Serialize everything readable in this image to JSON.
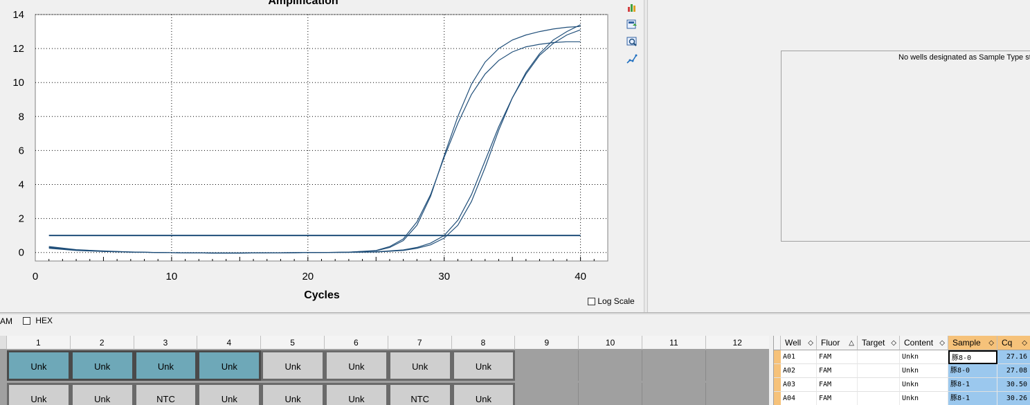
{
  "chart_data": {
    "type": "line",
    "title": "Amplification",
    "xlabel": "Cycles",
    "ylabel": "",
    "xlim": [
      0,
      42
    ],
    "ylim": [
      -0.5,
      14
    ],
    "xticks": [
      0,
      10,
      20,
      30,
      40
    ],
    "yticks": [
      0,
      2,
      4,
      6,
      8,
      10,
      12,
      14
    ],
    "grid": true,
    "threshold": 1.0,
    "series": [
      {
        "color": "#1f4e79",
        "x": [
          1,
          3,
          5,
          7,
          9,
          11,
          13,
          15,
          17,
          19,
          21,
          23,
          25,
          26,
          27,
          28,
          29,
          30,
          31,
          32,
          33,
          34,
          35,
          36,
          37,
          38,
          39,
          40
        ],
        "y": [
          0.3,
          0.15,
          0.08,
          0.03,
          0.0,
          -0.02,
          -0.03,
          -0.03,
          -0.02,
          -0.01,
          0.0,
          0.02,
          0.1,
          0.3,
          0.7,
          1.6,
          3.3,
          5.7,
          8.0,
          9.9,
          11.2,
          12.0,
          12.5,
          12.8,
          13.0,
          13.15,
          13.25,
          13.3
        ]
      },
      {
        "color": "#1f4e79",
        "x": [
          1,
          3,
          5,
          7,
          9,
          11,
          13,
          15,
          17,
          19,
          21,
          23,
          25,
          26,
          27,
          28,
          29,
          30,
          31,
          32,
          33,
          34,
          35,
          36,
          37,
          38,
          39,
          40
        ],
        "y": [
          0.35,
          0.17,
          0.09,
          0.03,
          0.0,
          -0.02,
          -0.03,
          -0.03,
          -0.02,
          -0.01,
          0.0,
          0.02,
          0.12,
          0.35,
          0.8,
          1.8,
          3.4,
          5.6,
          7.6,
          9.3,
          10.5,
          11.3,
          11.8,
          12.1,
          12.25,
          12.35,
          12.4,
          12.4
        ]
      },
      {
        "color": "#1f4e79",
        "x": [
          1,
          3,
          5,
          7,
          9,
          11,
          13,
          15,
          17,
          19,
          21,
          23,
          25,
          27,
          28,
          29,
          30,
          31,
          32,
          33,
          34,
          35,
          36,
          37,
          38,
          39,
          40
        ],
        "y": [
          0.25,
          0.12,
          0.06,
          0.02,
          0.0,
          -0.02,
          -0.03,
          -0.03,
          -0.02,
          -0.01,
          0.0,
          0.01,
          0.03,
          0.12,
          0.25,
          0.45,
          0.85,
          1.6,
          3.0,
          5.0,
          7.2,
          9.1,
          10.6,
          11.7,
          12.5,
          13.0,
          13.4
        ]
      },
      {
        "color": "#1f4e79",
        "x": [
          1,
          3,
          5,
          7,
          9,
          11,
          13,
          15,
          17,
          19,
          21,
          23,
          25,
          27,
          28,
          29,
          30,
          31,
          32,
          33,
          34,
          35,
          36,
          37,
          38,
          39,
          40
        ],
        "y": [
          0.3,
          0.14,
          0.07,
          0.02,
          0.0,
          -0.02,
          -0.03,
          -0.03,
          -0.02,
          -0.01,
          0.0,
          0.01,
          0.04,
          0.15,
          0.3,
          0.55,
          1.0,
          1.9,
          3.4,
          5.4,
          7.4,
          9.1,
          10.5,
          11.6,
          12.3,
          12.8,
          13.1
        ]
      }
    ]
  },
  "toolbar_icons": [
    "chart-settings-icon",
    "export-icon",
    "zoom-icon",
    "curve-icon"
  ],
  "info": {
    "message": "No wells designated as Sample Type sta"
  },
  "log_scale_label": "Log Scale",
  "fluor": {
    "fam_label": "AM",
    "hex_label": "HEX"
  },
  "plate": {
    "columns": [
      "1",
      "2",
      "3",
      "4",
      "5",
      "6",
      "7",
      "8",
      "9",
      "10",
      "11",
      "12"
    ],
    "row1": [
      "Unk",
      "Unk",
      "Unk",
      "Unk",
      "Unk",
      "Unk",
      "Unk",
      "Unk"
    ],
    "row2": [
      "Unk",
      "Unk",
      "NTC",
      "Unk",
      "Unk",
      "Unk",
      "NTC",
      "Unk"
    ]
  },
  "table": {
    "headers": {
      "well": "Well",
      "fluor": "Fluor",
      "target": "Target",
      "content": "Content",
      "sample": "Sample",
      "cq": "Cq"
    },
    "rows": [
      {
        "well": "A01",
        "fluor": "FAM",
        "target": "",
        "content": "Unkn",
        "sample": "豚8-0",
        "cq": "27.16"
      },
      {
        "well": "A02",
        "fluor": "FAM",
        "target": "",
        "content": "Unkn",
        "sample": "豚8-0",
        "cq": "27.08"
      },
      {
        "well": "A03",
        "fluor": "FAM",
        "target": "",
        "content": "Unkn",
        "sample": "豚8-1",
        "cq": "30.50"
      },
      {
        "well": "A04",
        "fluor": "FAM",
        "target": "",
        "content": "Unkn",
        "sample": "豚8-1",
        "cq": "30.26"
      }
    ]
  }
}
